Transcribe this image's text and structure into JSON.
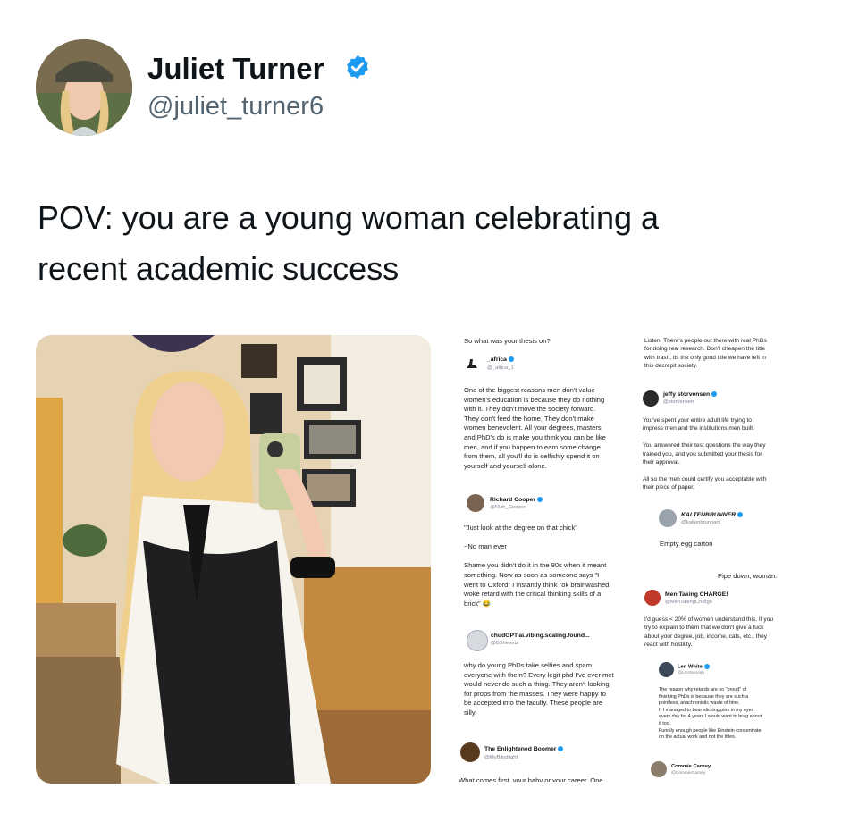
{
  "author": {
    "display_name": "Juliet Turner",
    "handle": "@juliet_turner6",
    "verified": true,
    "verified_color": "#1d9bf0",
    "icon": "verified-badge-icon"
  },
  "tweet": {
    "text_line1": "POV: you are a young woman celebrating a",
    "text_line2": "recent academic success"
  },
  "left_col": {
    "q1": "So what was your thesis on?",
    "r1_name": "_africa",
    "r1_handle": "@_africa_1",
    "r1_text": [
      "One of the biggest reasons men don't value",
      "women's education is because they do nothing",
      "with it. They don't move the society forward.",
      "They don't feed the home. They don't make",
      "women benevolent. All your degrees, masters",
      "and PhD's do is make you think you can be like",
      "men, and if you happen to earn some change",
      "from them, all you'll do is selfishly spend it on",
      "yourself and yourself alone."
    ],
    "r2_name": "Richard Cooper",
    "r2_handle": "@Rich_Cooper",
    "r2_text": [
      "\"Just look at the degree on that chick\"",
      "",
      "~No man ever",
      "",
      "Shame you didn't do it in the 80s when it meant",
      "something. Now as soon as someone says \"I",
      "went to Oxford\" I instantly think \"ok brainwashed",
      "woke retard with the critical thinking skills of a",
      "brick\" 😂"
    ],
    "r3_name": "chudGPT.ai.vibing.scaling.found...",
    "r3_handle": "@BSheeetz",
    "r3_text": [
      "why do young PhDs take selfies and spam",
      "everyone with them? Every legit phd I've ever met",
      "would never do such a thing.  They aren't looking",
      "for props from the masses. They were happy to",
      "be accepted into the faculty.  These people are",
      "silly."
    ],
    "r4_name": "The Enlightened Boomer",
    "r4_handle": "@MyBlindlight",
    "r4_text": "What comes first, your baby or your career. One"
  },
  "right_col": {
    "p1": [
      "Listen. There's people out there with real PhDs",
      "for doing real research. Don't cheapen the title",
      "with trash, its the only good title we have left in",
      "this decrepit society."
    ],
    "r5_name": "jeffy storvensen",
    "r5_handle": "@storvensen",
    "r5_text": [
      "You've spent your entire adult life trying to",
      "impress men and the institutions men built.",
      "",
      "You answered their test questions the way they",
      "trained you, and you submitted your thesis for",
      "their approval.",
      "",
      "All so the men could certify you acceptable with",
      "their piece of paper."
    ],
    "r6_name": "KALTENBRUNNER",
    "r6_handle": "@kaltenbrunnart",
    "r6_text": "Empty egg carton",
    "p2": "Pipe down, woman.",
    "r7_name": "Men Taking CHARGE!",
    "r7_handle": "@MenTakingCharge",
    "r7_text": [
      "I'd guess < 20% of women understand this. If you",
      "try to explain to them that we don't give a fuck",
      "about your degree, job, income, cats, etc., they",
      "react with hostility."
    ],
    "r8_name": "Len White",
    "r8_handle": "@LenSwoosh",
    "r8_text": [
      "The reason why retards are so \"proud\" of",
      "finishing PhDs is because they are such a",
      "pointless, anachronistic waste of time.",
      "If I managed to bear sticking pins in my eyes",
      "every day for 4 years I would want to brag about",
      "it too.",
      "Funnily enough people like Einstein concentrate",
      "on the actual work and not the titles."
    ],
    "r9_name": "Commie Carney",
    "r9_handle": "@CommieCarney"
  }
}
